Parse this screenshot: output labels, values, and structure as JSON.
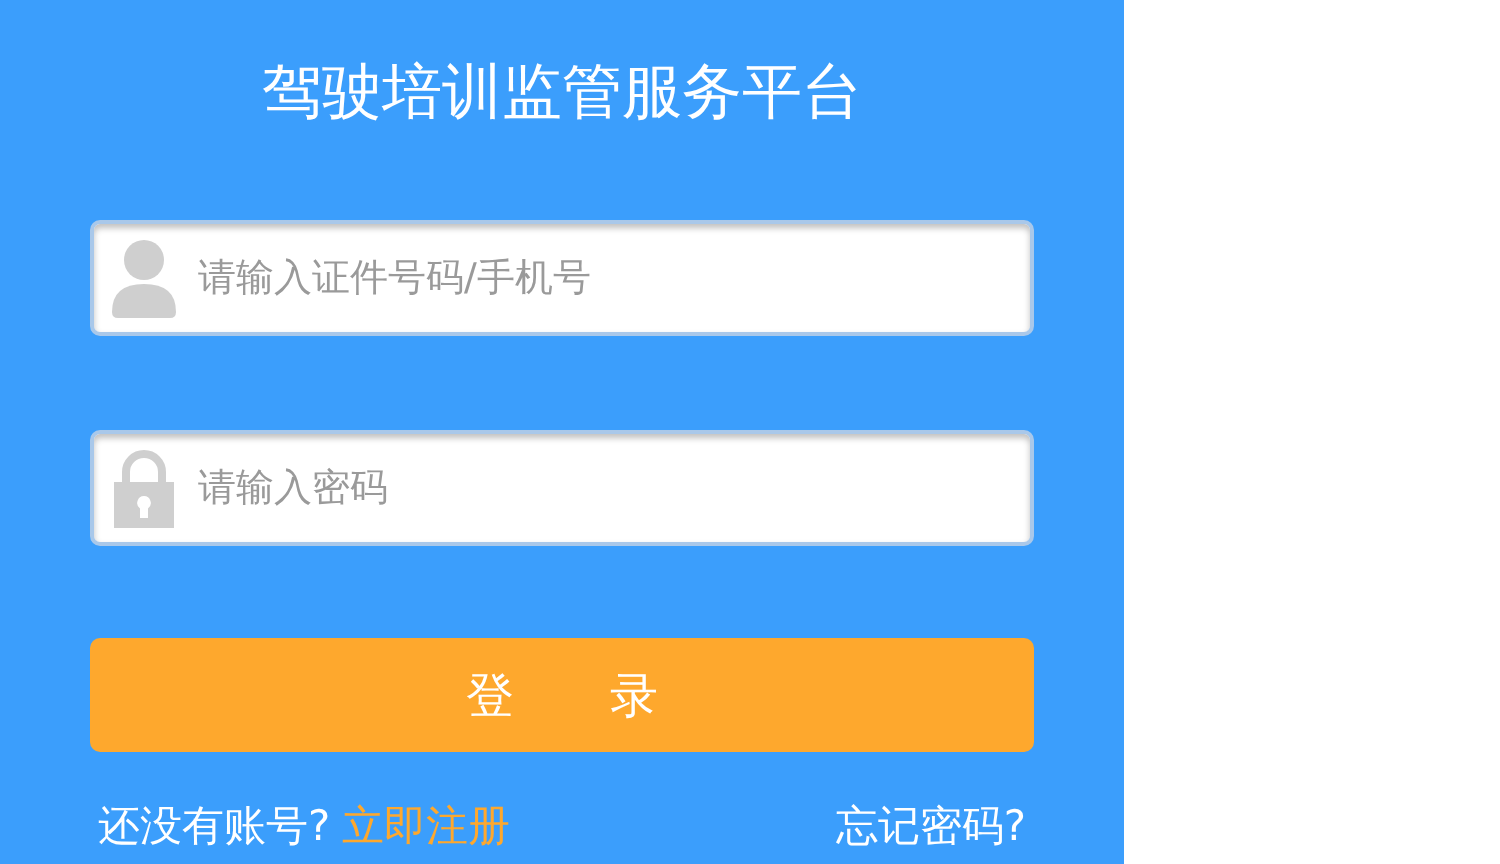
{
  "title": "驾驶培训监管服务平台",
  "fields": [
    {
      "kind": "user",
      "placeholder": "请输入证件号码/手机号"
    },
    {
      "kind": "password",
      "placeholder": "请输入密码"
    }
  ],
  "login_button": "登　　录",
  "register_prompt": "还没有账号?",
  "register_link": "立即注册",
  "forgot_link": "忘记密码?"
}
